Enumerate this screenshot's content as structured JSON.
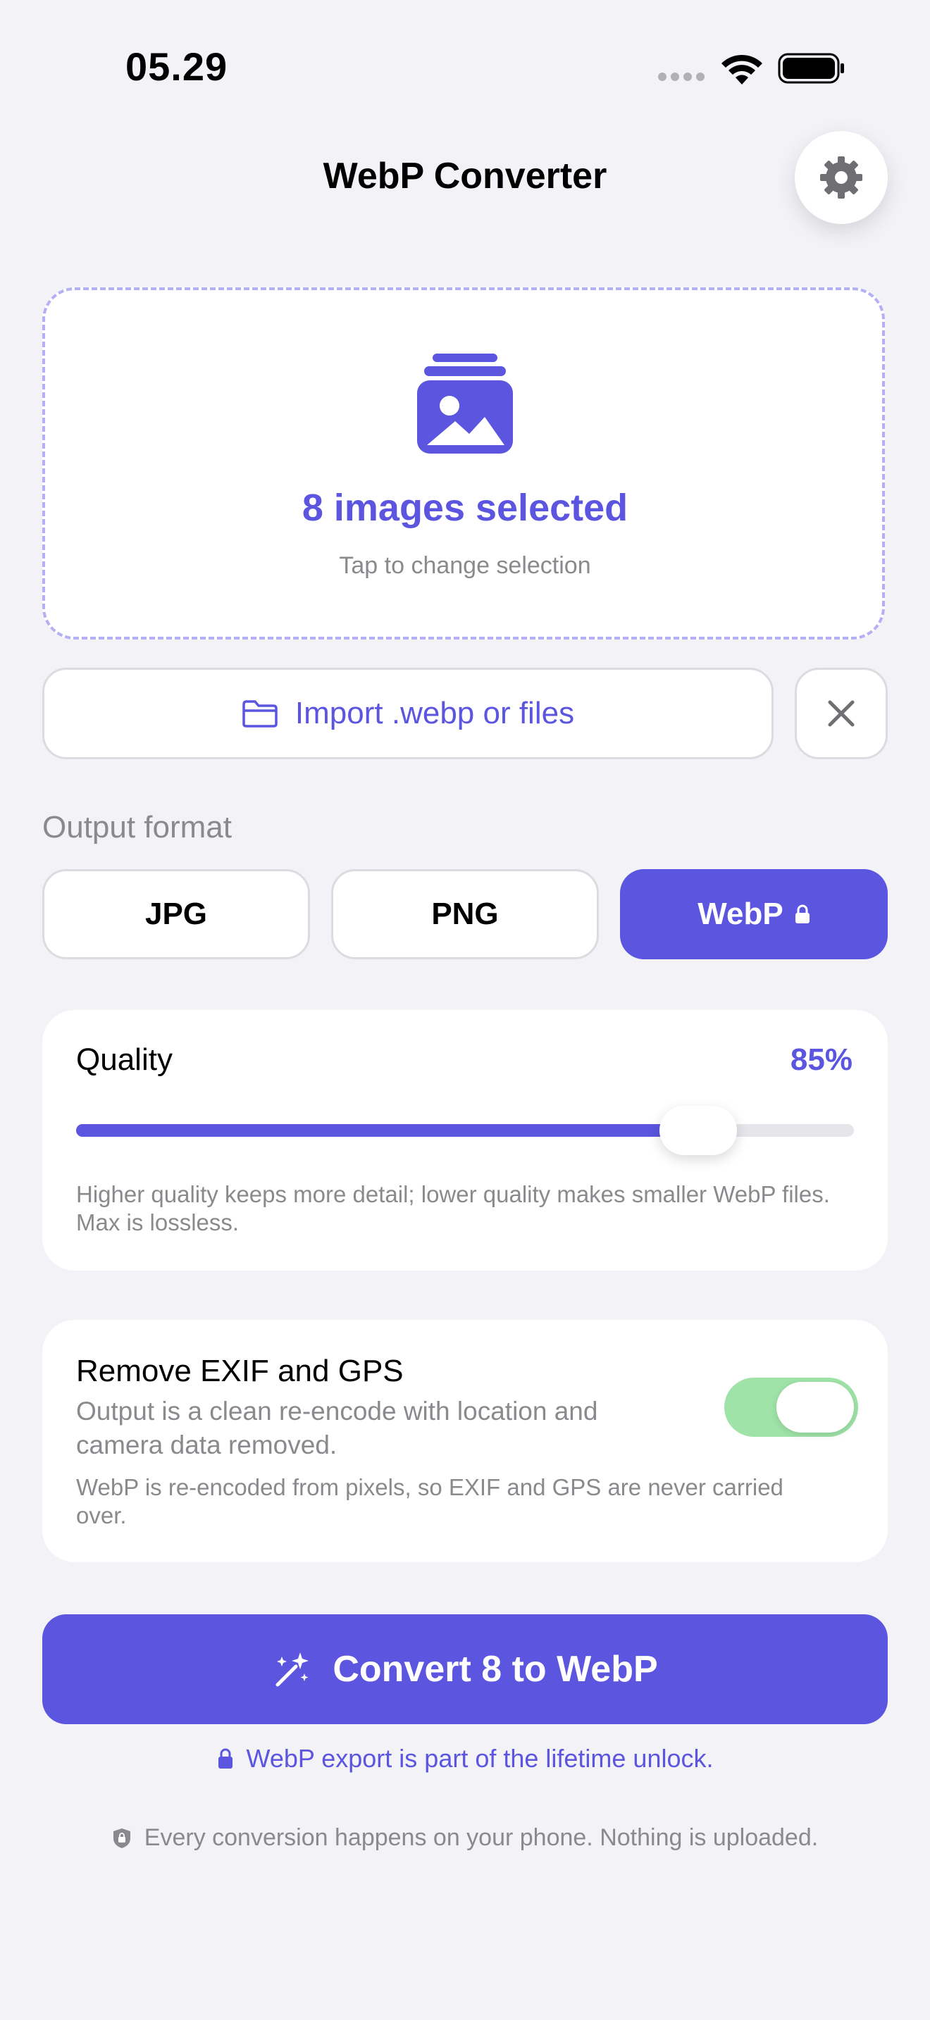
{
  "status_bar": {
    "time": "05.29"
  },
  "header": {
    "title": "WebP Converter",
    "settings_icon": "gear-icon"
  },
  "selection": {
    "icon": "photo-stack-icon",
    "title": "8 images selected",
    "subtitle": "Tap to change selection"
  },
  "import": {
    "label": "Import .webp or files",
    "icon": "folder-icon",
    "clear_icon": "close-icon"
  },
  "output_format": {
    "label": "Output format",
    "options": [
      {
        "label": "JPG",
        "selected": false
      },
      {
        "label": "PNG",
        "selected": false
      },
      {
        "label": "WebP",
        "selected": true,
        "locked": true
      }
    ]
  },
  "quality": {
    "label": "Quality",
    "value_text": "85%",
    "value": 0.85,
    "help": "Higher quality keeps more detail; lower quality makes smaller WebP files. Max is lossless."
  },
  "exif": {
    "title": "Remove EXIF and GPS",
    "description": "Output is a clean re-encode with location and camera data removed.",
    "note": "WebP is re-encoded from pixels, so EXIF and GPS are never carried over.",
    "enabled": true
  },
  "convert": {
    "label": "Convert 8 to WebP",
    "icon": "magic-wand-icon"
  },
  "unlock_note": {
    "text": "WebP export is part of the lifetime unlock.",
    "icon": "lock-icon"
  },
  "privacy_note": {
    "text": "Every conversion happens on your phone. Nothing is uploaded.",
    "icon": "shield-lock-icon"
  },
  "colors": {
    "accent": "#5b55e0",
    "background": "#f2f2f7",
    "toggle_on": "#9fe3a8",
    "secondary_text": "#8a8a8e"
  }
}
